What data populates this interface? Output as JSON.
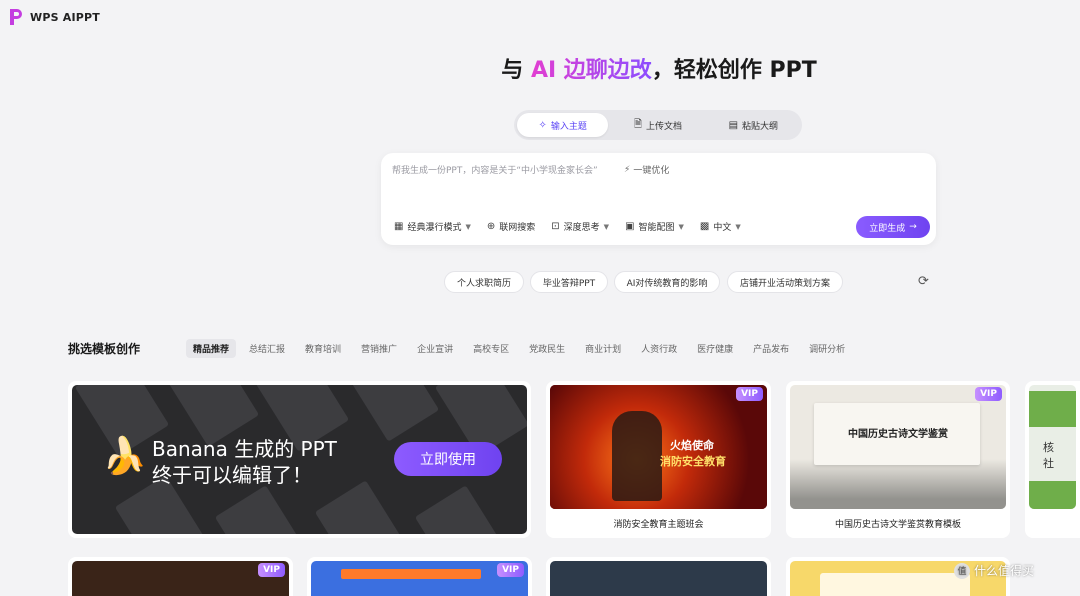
{
  "brand": {
    "name": "WPS AIPPT"
  },
  "hero": {
    "prefix": "与 ",
    "accent": "AI 边聊边改",
    "suffix": "，轻松创作 PPT"
  },
  "mode_tabs": [
    {
      "icon": "✧",
      "label": "输入主题"
    },
    {
      "icon": "🗎",
      "label": "上传文档"
    },
    {
      "icon": "▤",
      "label": "粘贴大纲"
    }
  ],
  "prompt": {
    "placeholder": "帮我生成一份PPT，内容是关于“中小学现金家长会”",
    "optimize_label": "一键优化"
  },
  "options": [
    {
      "icon": "▦",
      "label": "经典瀑行模式"
    },
    {
      "icon": "⊕",
      "label": "联网搜索"
    },
    {
      "icon": "⊡",
      "label": "深度思考"
    },
    {
      "icon": "▣",
      "label": "智能配图"
    },
    {
      "icon": "▩",
      "label": "中文"
    }
  ],
  "generate": {
    "label": "立即生成",
    "arrow": "→"
  },
  "suggestions": [
    "个人求职简历",
    "毕业答辩PPT",
    "AI对传统教育的影响",
    "店铺开业活动策划方案"
  ],
  "section": {
    "title": "挑选模板创作",
    "categories": [
      "精品推荐",
      "总结汇报",
      "教育培训",
      "营销推广",
      "企业宣讲",
      "高校专区",
      "党政民生",
      "商业计划",
      "人资行政",
      "医疗健康",
      "产品发布",
      "调研分析"
    ]
  },
  "banner": {
    "line1": "Banana 生成的 PPT",
    "line2": "终于可以编辑了！",
    "button": "立即使用"
  },
  "templates": [
    {
      "title": "消防安全教育主题班会",
      "thumb_text": [
        "火焰使命",
        "消防安全教育"
      ],
      "vip": "VIP"
    },
    {
      "title": "中国历史古诗文学鉴赏教育模板",
      "thumb_text": [
        "中国历史古诗文学鉴赏"
      ],
      "vip": "VIP"
    },
    {
      "title": "",
      "thumb_text": [
        "核",
        "社"
      ],
      "vip": ""
    }
  ],
  "bottom_vips": [
    "VIP",
    "VIP"
  ],
  "watermark": {
    "icon": "值",
    "text": "什么值得买"
  }
}
